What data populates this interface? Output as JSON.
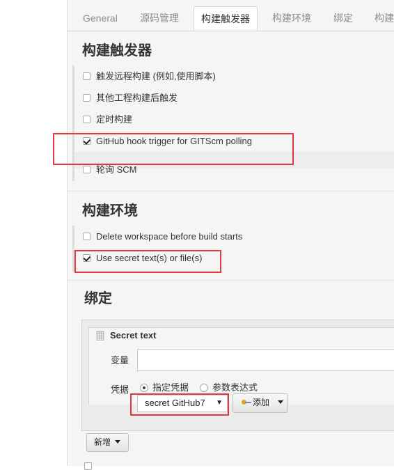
{
  "tabs": [
    "General",
    "源码管理",
    "构建触发器",
    "构建环境",
    "绑定",
    "构建"
  ],
  "sections": {
    "triggers": {
      "title": "构建触发器",
      "options": [
        {
          "label": "触发远程构建 (例如,使用脚本)",
          "checked": false
        },
        {
          "label": "其他工程构建后触发",
          "checked": false
        },
        {
          "label": "定时构建",
          "checked": false
        },
        {
          "label": "GitHub hook trigger for GITScm polling",
          "checked": true
        },
        {
          "label": "轮询 SCM",
          "checked": false
        }
      ]
    },
    "environment": {
      "title": "构建环境",
      "options": [
        {
          "label": "Delete workspace before build starts",
          "checked": false
        },
        {
          "label": "Use secret text(s) or file(s)",
          "checked": true
        }
      ]
    },
    "bindings": {
      "title": "绑定",
      "card_title": "Secret text",
      "variable_label": "变量",
      "variable_value": "",
      "credentials_label": "凭据",
      "radio_specific": "指定凭据",
      "radio_param": "参数表达式",
      "selected_credential": "secret GitHub7",
      "add_button": "添加",
      "new_button": "新增"
    }
  },
  "colors": {
    "highlight": "#e0393e"
  }
}
